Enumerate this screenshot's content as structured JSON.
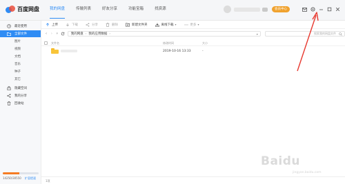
{
  "app": {
    "logo_text": "百度网盘",
    "nav_tabs": [
      "我的网盘",
      "传输列表",
      "好友分享",
      "功能宝箱",
      "找资源"
    ],
    "member_button": "会员中心"
  },
  "sidebar": {
    "items": [
      {
        "label": "最近使用",
        "icon": "clock-icon"
      },
      {
        "label": "全部文件",
        "icon": "folder-icon",
        "active": true
      },
      {
        "label": "图片",
        "sub": true
      },
      {
        "label": "视频",
        "sub": true
      },
      {
        "label": "文档",
        "sub": true
      },
      {
        "label": "音乐",
        "sub": true
      },
      {
        "label": "种子",
        "sub": true
      },
      {
        "label": "其它",
        "sub": true
      },
      {
        "label": "隐藏空间",
        "icon": "lock-icon"
      },
      {
        "label": "我的分享",
        "icon": "share-icon"
      },
      {
        "label": "回收站",
        "icon": "trash-icon"
      }
    ],
    "quota_text": "14250/30550",
    "quota_fraction": 0.47,
    "expand_link": "扩容提速"
  },
  "toolbar": {
    "items": [
      {
        "label": "上传",
        "icon": "upload-icon",
        "disabled": false
      },
      {
        "label": "下载",
        "icon": "download-icon",
        "disabled": true
      },
      {
        "label": "分享",
        "icon": "share-icon",
        "disabled": true
      },
      {
        "label": "删除",
        "icon": "trash-icon",
        "disabled": true
      },
      {
        "label": "新建文件夹",
        "icon": "new-folder-icon",
        "disabled": false
      },
      {
        "label": "离线下载",
        "icon": "offline-download-icon",
        "disabled": false,
        "caret": true
      },
      {
        "label": "更多",
        "icon": "more-icon",
        "disabled": true,
        "caret": true
      }
    ]
  },
  "path": {
    "segments": [
      "我的网盘",
      "我的应用数据"
    ],
    "search_placeholder": "搜索我的网盘文件"
  },
  "table": {
    "headers": {
      "name": "文件名",
      "modified": "修改时间",
      "size": "大小"
    },
    "rows": [
      {
        "name": "",
        "modified": "2019-10-16 13:33",
        "size": "-"
      }
    ]
  },
  "status": {
    "text": "1项"
  },
  "watermark": {
    "text": "Baidu",
    "sub": "jingyan.baidu.com"
  },
  "colors": {
    "accent": "#2f8cf4",
    "arrow": "#e8392f",
    "member": "#f0a22e",
    "quota": "#f57c23"
  }
}
